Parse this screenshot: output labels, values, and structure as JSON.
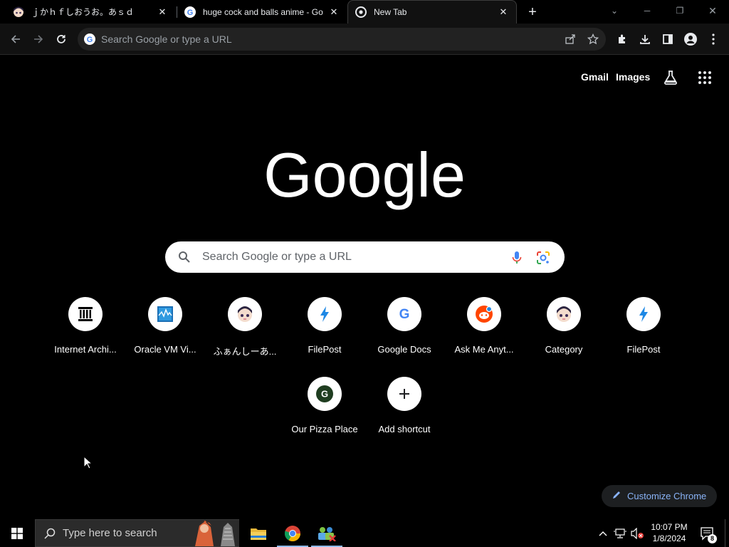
{
  "tabs": [
    {
      "title": "ｊかｈｆしおうお。あｓｄ",
      "active": false
    },
    {
      "title": "huge cock and balls anime - Go",
      "active": false
    },
    {
      "title": "New Tab",
      "active": true
    }
  ],
  "toolbar": {
    "omnibox_placeholder": "Search Google or type a URL"
  },
  "ntp": {
    "gmail_label": "Gmail",
    "images_label": "Images",
    "search_placeholder": "Search Google or type a URL",
    "shortcuts": [
      {
        "label": "Internet Archi...",
        "icon": "archive-icon"
      },
      {
        "label": "Oracle VM Vi...",
        "icon": "virtualbox-icon"
      },
      {
        "label": "ふぁんしーあ...",
        "icon": "anime-face-icon"
      },
      {
        "label": "FilePost",
        "icon": "bolt-icon"
      },
      {
        "label": "Google Docs",
        "icon": "google-g-icon"
      },
      {
        "label": "Ask Me Anyt...",
        "icon": "reddit-icon"
      },
      {
        "label": "Category",
        "icon": "anime-face-icon"
      },
      {
        "label": "FilePost",
        "icon": "bolt-icon"
      },
      {
        "label": "Our Pizza Place",
        "icon": "letter-g-icon"
      },
      {
        "label": "Add shortcut",
        "icon": "plus-icon"
      }
    ],
    "customize_label": "Customize Chrome"
  },
  "taskbar": {
    "search_placeholder": "Type here to search",
    "time": "10:07 PM",
    "date": "1/8/2024",
    "notification_count": "8"
  },
  "colors": {
    "accent_blue": "#8ab4f8",
    "omnibox_bg": "#222222",
    "toolbar_bg": "#111111"
  }
}
